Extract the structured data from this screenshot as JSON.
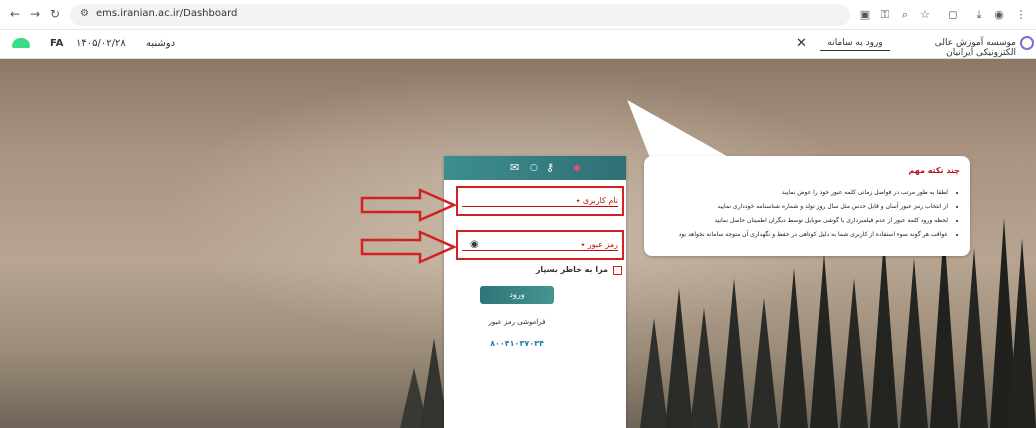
{
  "browser": {
    "url": "ems.iranian.ac.ir/Dashboard",
    "back_icon": "back-arrow-icon",
    "forward_icon": "forward-arrow-icon",
    "reload_icon": "reload-icon"
  },
  "appbar": {
    "lang": "FA",
    "date": "۱۴۰۵/۰۲/۲۸",
    "weekday": "دوشنبه",
    "tab_title": "ورود به سامانه",
    "close_symbol": "✕",
    "site_title": "موسسه آموزش عالی الکترونیکی ایرانیان"
  },
  "info": {
    "title": "چند نکته مهم",
    "items": [
      "لطفا به طور مرتب در فواصل زمانی کلمه عبور خود را عوض نمایید",
      "از انتخاب رمز عبور آسان و قابل حدس مثل سال روز تولد و شماره شناسنامه خودداری نمایید",
      "لحظه ورود کلمه عبور از عدم فیلمبرداری با گوشی موبایل توسط دیگران اطمینان حاصل نمایید",
      "عواقب هر گونه سوء استفاده از کاربری شما به دلیل کوتاهی در حفظ و نگهداری آن متوجه سامانه نخواهد بود"
    ]
  },
  "login": {
    "username_label": "نام کاربری ٭",
    "password_label": "رمز عبور ٭",
    "remember_label": "مرا به خاطر بسپار",
    "submit_label": "ورود",
    "forgot_label": "فراموشی رمز عبور",
    "phone": "۸۰۰۴۱۰۳۷۰۳۴"
  },
  "colors": {
    "header_teal": "#3d8e8e",
    "annotation_red": "#d42020",
    "link_blue": "#2a7ea8"
  }
}
